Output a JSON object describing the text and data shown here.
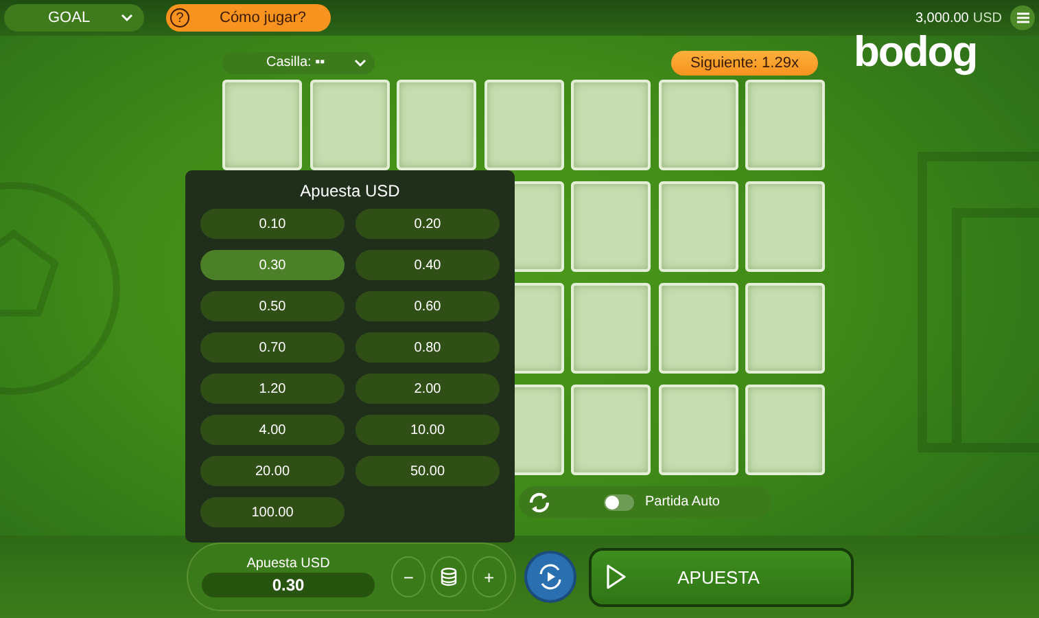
{
  "top_bar": {
    "game_menu": {
      "label": "GOAL"
    },
    "help_button": {
      "icon": "?",
      "label": "Cómo jugar?"
    },
    "balance": {
      "amount": "3,000.00",
      "currency": "USD"
    }
  },
  "logo": "bodog",
  "board": {
    "size_select": {
      "label": "Casilla:",
      "value": "▪▪"
    },
    "next_multiplier": "Siguiente: 1.29x",
    "tile_rows": [
      {
        "tiles": [
          {
            "covered": true
          },
          {
            "covered": true
          },
          {
            "covered": true
          },
          {
            "covered": true
          },
          {
            "covered": true
          },
          {
            "covered": true
          },
          {
            "covered": true
          }
        ]
      },
      {
        "tiles": [
          {
            "covered": true
          },
          {
            "covered": true
          },
          {
            "covered": true
          },
          {
            "covered": true
          }
        ]
      },
      {
        "tiles": [
          {
            "covered": true
          },
          {
            "covered": true
          },
          {
            "covered": true
          },
          {
            "covered": true
          }
        ]
      },
      {
        "tiles": [
          {
            "covered": true
          },
          {
            "covered": true
          },
          {
            "covered": true
          },
          {
            "covered": true
          }
        ]
      }
    ]
  },
  "bet_popup": {
    "title": "Apuesta USD",
    "options": [
      {
        "label": "0.10",
        "selected": false
      },
      {
        "label": "0.20",
        "selected": false
      },
      {
        "label": "0.30",
        "selected": true
      },
      {
        "label": "0.40",
        "selected": false
      },
      {
        "label": "0.50",
        "selected": false
      },
      {
        "label": "0.60",
        "selected": false
      },
      {
        "label": "0.70",
        "selected": false
      },
      {
        "label": "0.80",
        "selected": false
      },
      {
        "label": "1.20",
        "selected": false
      },
      {
        "label": "2.00",
        "selected": false
      },
      {
        "label": "4.00",
        "selected": false
      },
      {
        "label": "10.00",
        "selected": false
      },
      {
        "label": "20.00",
        "selected": false
      },
      {
        "label": "50.00",
        "selected": false
      },
      {
        "label": "100.00",
        "selected": false
      }
    ]
  },
  "auto_play": {
    "label": "Partida Auto",
    "on": false
  },
  "bottom_bar": {
    "bet_control": {
      "label": "Apuesta USD",
      "value": "0.30",
      "minus": "−",
      "plus": "+"
    },
    "bet_button": {
      "label": "APUESTA"
    }
  }
}
